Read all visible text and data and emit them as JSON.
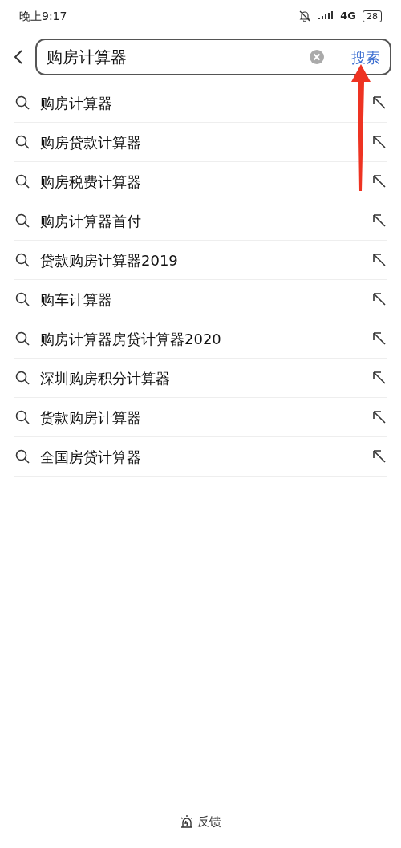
{
  "status_bar": {
    "time": "晚上9:17",
    "network": "4G",
    "battery": "28"
  },
  "search": {
    "value": "购房计算器",
    "button": "搜索"
  },
  "suggestions": [
    {
      "text": "购房计算器"
    },
    {
      "text": "购房贷款计算器"
    },
    {
      "text": "购房税费计算器"
    },
    {
      "text": "购房计算器首付"
    },
    {
      "text": "贷款购房计算器2019"
    },
    {
      "text": "购车计算器"
    },
    {
      "text": "购房计算器房贷计算器2020"
    },
    {
      "text": "深圳购房积分计算器"
    },
    {
      "text": "货款购房计算器"
    },
    {
      "text": "全国房贷计算器"
    }
  ],
  "footer": {
    "label": "反馈"
  }
}
